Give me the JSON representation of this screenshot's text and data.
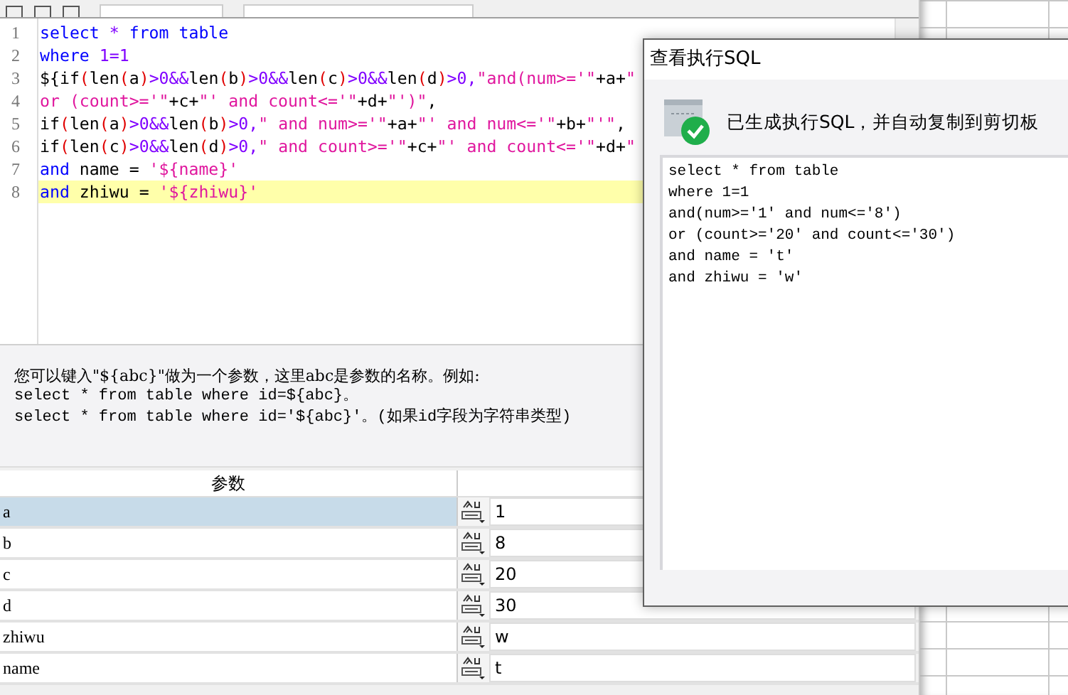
{
  "editor": {
    "lines": [
      {
        "number": "1",
        "highlighted": false,
        "tokens": [
          {
            "kind": "kw",
            "text": "select"
          },
          {
            "kind": "num",
            "text": " * "
          },
          {
            "kind": "kw",
            "text": "from"
          },
          {
            "kind": "kw",
            "text": " table"
          }
        ]
      },
      {
        "number": "2",
        "highlighted": false,
        "tokens": [
          {
            "kind": "kw",
            "text": "where"
          },
          {
            "kind": "num",
            "text": " 1=1"
          }
        ]
      },
      {
        "number": "3",
        "highlighted": false,
        "tokens": [
          {
            "kind": "plain",
            "text": "${if"
          },
          {
            "kind": "paren",
            "text": "("
          },
          {
            "kind": "plain",
            "text": "len"
          },
          {
            "kind": "paren",
            "text": "("
          },
          {
            "kind": "plain",
            "text": "a"
          },
          {
            "kind": "paren",
            "text": ")"
          },
          {
            "kind": "num",
            "text": ">0&&"
          },
          {
            "kind": "plain",
            "text": "len"
          },
          {
            "kind": "paren",
            "text": "("
          },
          {
            "kind": "plain",
            "text": "b"
          },
          {
            "kind": "paren",
            "text": ")"
          },
          {
            "kind": "num",
            "text": ">0&&"
          },
          {
            "kind": "plain",
            "text": "len"
          },
          {
            "kind": "paren",
            "text": "("
          },
          {
            "kind": "plain",
            "text": "c"
          },
          {
            "kind": "paren",
            "text": ")"
          },
          {
            "kind": "num",
            "text": ">0&&"
          },
          {
            "kind": "plain",
            "text": "len"
          },
          {
            "kind": "paren",
            "text": "("
          },
          {
            "kind": "plain",
            "text": "d"
          },
          {
            "kind": "paren",
            "text": ")"
          },
          {
            "kind": "num",
            "text": ">0,"
          },
          {
            "kind": "str",
            "text": "\"and(num>='\""
          },
          {
            "kind": "plain",
            "text": "+a+"
          },
          {
            "kind": "str",
            "text": "\""
          }
        ]
      },
      {
        "number": "4",
        "highlighted": false,
        "tokens": [
          {
            "kind": "str",
            "text": "or (count>='\""
          },
          {
            "kind": "plain",
            "text": "+c+"
          },
          {
            "kind": "str",
            "text": "\"' and count<='\""
          },
          {
            "kind": "plain",
            "text": "+d+"
          },
          {
            "kind": "str",
            "text": "\"')\""
          },
          {
            "kind": "plain",
            "text": ","
          }
        ]
      },
      {
        "number": "5",
        "highlighted": false,
        "tokens": [
          {
            "kind": "plain",
            "text": "if"
          },
          {
            "kind": "paren",
            "text": "("
          },
          {
            "kind": "plain",
            "text": "len"
          },
          {
            "kind": "paren",
            "text": "("
          },
          {
            "kind": "plain",
            "text": "a"
          },
          {
            "kind": "paren",
            "text": ")"
          },
          {
            "kind": "num",
            "text": ">0&&"
          },
          {
            "kind": "plain",
            "text": "len"
          },
          {
            "kind": "paren",
            "text": "("
          },
          {
            "kind": "plain",
            "text": "b"
          },
          {
            "kind": "paren",
            "text": ")"
          },
          {
            "kind": "num",
            "text": ">0,"
          },
          {
            "kind": "str",
            "text": "\" and num>='\""
          },
          {
            "kind": "plain",
            "text": "+a+"
          },
          {
            "kind": "str",
            "text": "\"' and num<='\""
          },
          {
            "kind": "plain",
            "text": "+b+"
          },
          {
            "kind": "str",
            "text": "\"'\""
          },
          {
            "kind": "plain",
            "text": ","
          }
        ]
      },
      {
        "number": "6",
        "highlighted": false,
        "tokens": [
          {
            "kind": "plain",
            "text": "if"
          },
          {
            "kind": "paren",
            "text": "("
          },
          {
            "kind": "plain",
            "text": "len"
          },
          {
            "kind": "paren",
            "text": "("
          },
          {
            "kind": "plain",
            "text": "c"
          },
          {
            "kind": "paren",
            "text": ")"
          },
          {
            "kind": "num",
            "text": ">0&&"
          },
          {
            "kind": "plain",
            "text": "len"
          },
          {
            "kind": "paren",
            "text": "("
          },
          {
            "kind": "plain",
            "text": "d"
          },
          {
            "kind": "paren",
            "text": ")"
          },
          {
            "kind": "num",
            "text": ">0,"
          },
          {
            "kind": "str",
            "text": "\" and count>='\""
          },
          {
            "kind": "plain",
            "text": "+c+"
          },
          {
            "kind": "str",
            "text": "\"' and count<='\""
          },
          {
            "kind": "plain",
            "text": "+d+"
          },
          {
            "kind": "str",
            "text": "\""
          }
        ]
      },
      {
        "number": "7",
        "highlighted": false,
        "tokens": [
          {
            "kind": "kw",
            "text": "and"
          },
          {
            "kind": "plain",
            "text": " name = "
          },
          {
            "kind": "str",
            "text": "'${name}'"
          }
        ]
      },
      {
        "number": "8",
        "highlighted": true,
        "tokens": [
          {
            "kind": "kw",
            "text": "and"
          },
          {
            "kind": "plain",
            "text": " zhiwu = "
          },
          {
            "kind": "str",
            "text": "'${zhiwu}'"
          }
        ]
      }
    ]
  },
  "hint": {
    "lines": [
      "您可以键入\"${abc}\"做为一个参数，这里abc是参数的名称。例如:",
      "select * from table where id=${abc}。",
      "select * from table where id='${abc}'。(如果id字段为字符串类型)"
    ]
  },
  "params": {
    "columns": [
      "参数"
    ],
    "rows": [
      {
        "name": "a",
        "value": "1",
        "selected": true
      },
      {
        "name": "b",
        "value": "8",
        "selected": false
      },
      {
        "name": "c",
        "value": "20",
        "selected": false
      },
      {
        "name": "d",
        "value": "30",
        "selected": false
      },
      {
        "name": "zhiwu",
        "value": "w",
        "selected": false
      },
      {
        "name": "name",
        "value": "t",
        "selected": false
      }
    ]
  },
  "dialog": {
    "title": "查看执行SQL",
    "message": "已生成执行SQL，并自动复制到剪切板",
    "sql_lines": [
      "select * from table",
      "where 1=1",
      "and(num>='1' and num<='8')",
      "or (count>='20' and count<='30')",
      "and name = 't'",
      "and zhiwu = 'w'"
    ]
  }
}
